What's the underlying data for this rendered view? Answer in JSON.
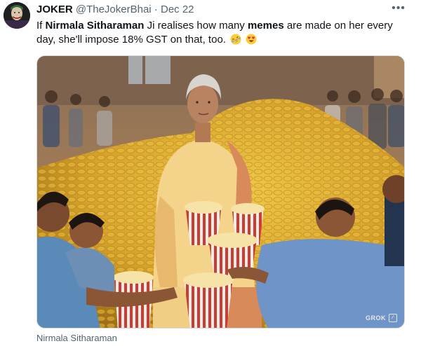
{
  "tweet": {
    "author_name": "JOKER",
    "handle": "@TheJokerBhai",
    "separator": "·",
    "date": "Dec 22",
    "text": {
      "p1": "If ",
      "b1": "Nirmala Sitharaman",
      "p2": " Ji realises how many ",
      "b2": "memes",
      "p3": " are made on her every day, she'll impose 18% GST on that, too."
    },
    "emojis": [
      "rofl-emoji",
      "heart-eyes-emoji"
    ],
    "more_label": "•••"
  },
  "media": {
    "watermark": "GROK",
    "caption": "Nirmala Sitharaman"
  },
  "colors": {
    "text": "#0f1419",
    "secondary": "#536471",
    "gold": "#d9a928",
    "saree": "#f3d48a"
  }
}
